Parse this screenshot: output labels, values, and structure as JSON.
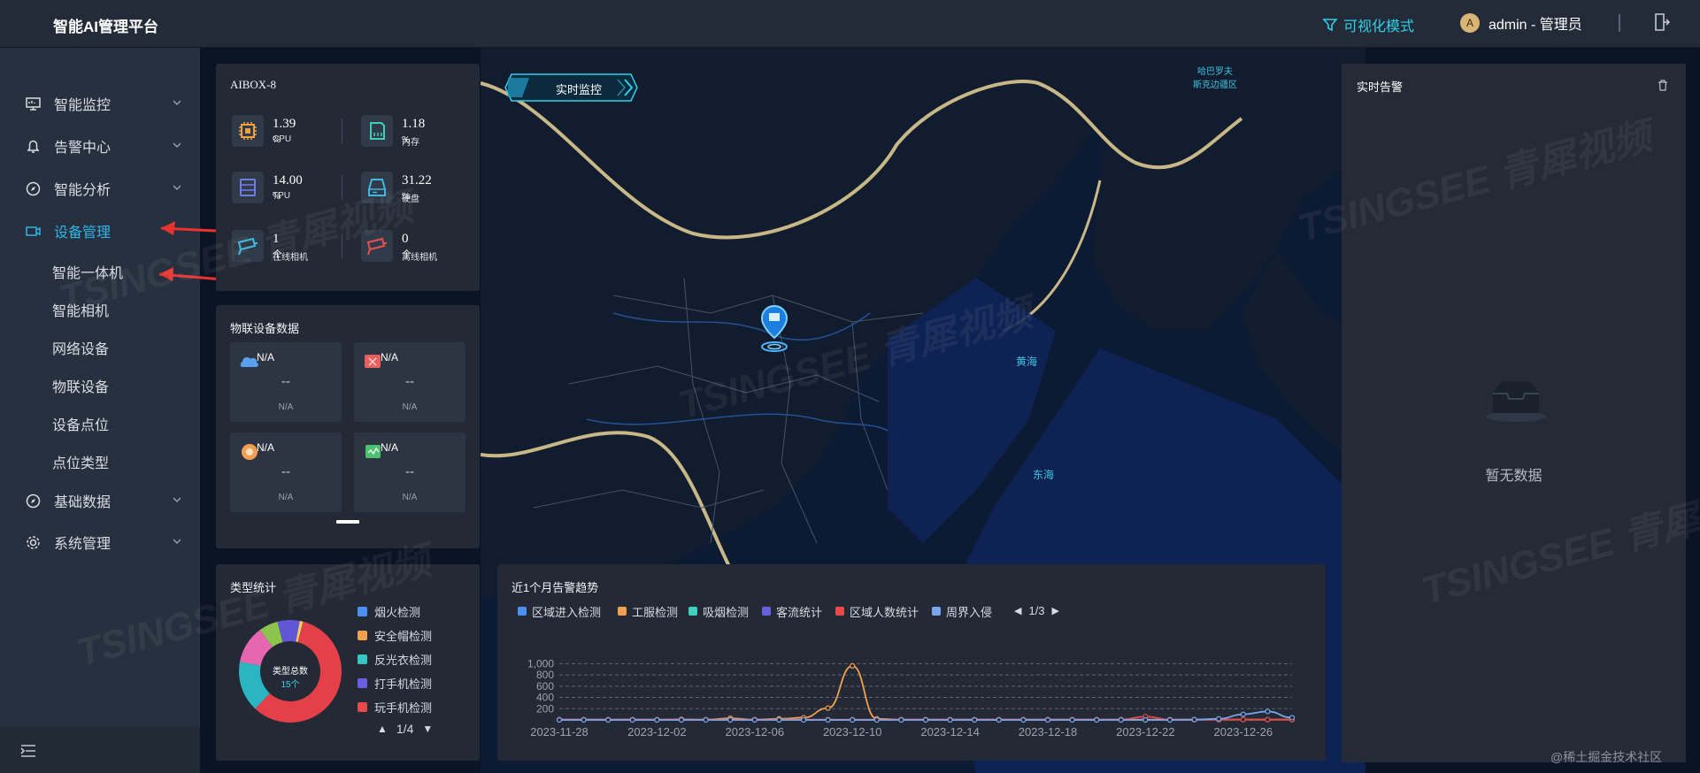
{
  "header": {
    "title": "智能AI管理平台",
    "vis_mode": "可视化模式",
    "avatar_letter": "A",
    "user": "admin - 管理员"
  },
  "sidebar": {
    "items": [
      {
        "label": "智能监控",
        "icon": "monitor-icon"
      },
      {
        "label": "告警中心",
        "icon": "bell-icon"
      },
      {
        "label": "智能分析",
        "icon": "compass-icon"
      },
      {
        "label": "设备管理",
        "icon": "camera-device-icon"
      },
      {
        "label": "基础数据",
        "icon": "compass-icon"
      },
      {
        "label": "系统管理",
        "icon": "gear-icon"
      }
    ],
    "sub_items": [
      "智能一体机",
      "智能相机",
      "网络设备",
      "物联设备",
      "设备点位",
      "点位类型"
    ]
  },
  "annotations": {
    "arrow1": "1",
    "arrow2": "2"
  },
  "device": {
    "name": "AIBOX-8",
    "stats": [
      {
        "value": "1.39",
        "unit": " %",
        "label": "CPU"
      },
      {
        "value": "1.18",
        "unit": " %",
        "label": "内存"
      },
      {
        "value": "14.00",
        "unit": " %",
        "label": "TPU"
      },
      {
        "value": "31.22",
        "unit": " %",
        "label": "硬盘"
      },
      {
        "value": "1",
        "unit": " 个",
        "label": "在线相机"
      },
      {
        "value": "0",
        "unit": " 个",
        "label": "离线相机"
      }
    ]
  },
  "iot": {
    "title": "物联设备数据",
    "cards": [
      {
        "title": "N/A",
        "value": "--",
        "sub": "N/A"
      },
      {
        "title": "N/A",
        "value": "--",
        "sub": "N/A"
      },
      {
        "title": "N/A",
        "value": "--",
        "sub": "N/A"
      },
      {
        "title": "N/A",
        "value": "--",
        "sub": "N/A"
      }
    ]
  },
  "types": {
    "title": "类型统计",
    "center_label": "类型总数",
    "center_value": "15个",
    "legend": [
      {
        "label": "烟火检测",
        "color": "#4b8ff0"
      },
      {
        "label": "安全帽检测",
        "color": "#f0a050"
      },
      {
        "label": "反光衣检测",
        "color": "#38c6c0"
      },
      {
        "label": "打手机检测",
        "color": "#6a5fe0"
      },
      {
        "label": "玩手机检测",
        "color": "#e84a4a"
      }
    ],
    "page": "1/4",
    "slices": [
      {
        "color": "#e5404a",
        "value": 58
      },
      {
        "color": "#2bb5c2",
        "value": 16
      },
      {
        "color": "#e467b0",
        "value": 12
      },
      {
        "color": "#8cc44e",
        "value": 6
      },
      {
        "color": "#6157d6",
        "value": 7
      },
      {
        "color": "#f0d060",
        "value": 1
      }
    ]
  },
  "trend": {
    "title": "近1个月告警趋势",
    "legend": [
      {
        "label": "区域进入检测",
        "color": "#4b8ff0"
      },
      {
        "label": "工服检测",
        "color": "#f0a050"
      },
      {
        "label": "吸烟检测",
        "color": "#3fd0c0"
      },
      {
        "label": "客流统计",
        "color": "#6a5fe0"
      },
      {
        "label": "区域人数统计",
        "color": "#e84a4a"
      },
      {
        "label": "周界入侵",
        "color": "#7aa6f0"
      }
    ],
    "page": "1/3"
  },
  "chart_data": {
    "type": "line",
    "title": "近1个月告警趋势",
    "x": [
      "2023-11-28",
      "2023-11-29",
      "2023-11-30",
      "2023-12-01",
      "2023-12-02",
      "2023-12-03",
      "2023-12-04",
      "2023-12-05",
      "2023-12-06",
      "2023-12-07",
      "2023-12-08",
      "2023-12-09",
      "2023-12-10",
      "2023-12-11",
      "2023-12-12",
      "2023-12-13",
      "2023-12-14",
      "2023-12-15",
      "2023-12-16",
      "2023-12-17",
      "2023-12-18",
      "2023-12-19",
      "2023-12-20",
      "2023-12-21",
      "2023-12-22",
      "2023-12-23",
      "2023-12-24",
      "2023-12-25",
      "2023-12-26",
      "2023-12-27",
      "2023-12-28"
    ],
    "xticks": [
      "2023-11-28",
      "2023-12-02",
      "2023-12-06",
      "2023-12-10",
      "2023-12-14",
      "2023-12-18",
      "2023-12-22",
      "2023-12-26"
    ],
    "yticks": [
      "1,000",
      "800",
      "600",
      "400",
      "200"
    ],
    "ylim": [
      0,
      1100
    ],
    "series": [
      {
        "name": "工服检测",
        "color": "#f0a050",
        "values": [
          5,
          5,
          5,
          5,
          5,
          10,
          5,
          30,
          5,
          20,
          40,
          210,
          960,
          20,
          5,
          5,
          5,
          5,
          5,
          5,
          5,
          5,
          5,
          5,
          5,
          5,
          5,
          5,
          5,
          5,
          5
        ]
      },
      {
        "name": "区域人数统计",
        "color": "#e84a4a",
        "values": [
          5,
          5,
          5,
          5,
          5,
          5,
          5,
          5,
          5,
          5,
          5,
          5,
          5,
          5,
          5,
          5,
          5,
          5,
          5,
          5,
          5,
          5,
          5,
          5,
          60,
          5,
          5,
          5,
          5,
          5,
          5
        ]
      },
      {
        "name": "周界入侵",
        "color": "#7aa6f0",
        "values": [
          0,
          0,
          0,
          0,
          0,
          0,
          0,
          0,
          0,
          0,
          0,
          0,
          0,
          0,
          0,
          0,
          0,
          0,
          0,
          0,
          0,
          0,
          0,
          0,
          0,
          0,
          5,
          20,
          100,
          150,
          40
        ]
      }
    ]
  },
  "map": {
    "tab": "实时监控",
    "labels": [
      "黄海",
      "东海",
      "哈巴罗夫\n斯克边疆区"
    ]
  },
  "alarm": {
    "title": "实时告警",
    "empty": "暂无数据"
  },
  "footer": {
    "credit": "@稀土掘金技术社区"
  },
  "watermark": "TSINGSEE 青犀视频"
}
